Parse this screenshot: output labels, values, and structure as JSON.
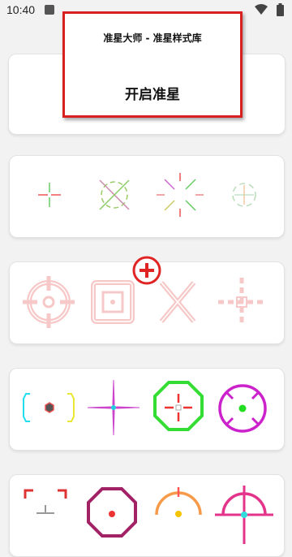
{
  "status_bar": {
    "time": "10:40"
  },
  "overlay": {
    "title": "准星大师 - 准星样式库",
    "open_button": "开启准星"
  },
  "crosshair_rows": [
    {
      "items": [
        "green-red-plus-icon",
        "rainbow-circle-x-icon",
        "rainbow-dashes-x-icon",
        "pastel-circle-plus-icon"
      ]
    },
    {
      "items": [
        "red-glow-circle-icon",
        "red-glow-square-icon",
        "red-glow-x-icon",
        "red-glow-dashed-plus-icon"
      ]
    },
    {
      "items": [
        "cyan-yellow-brackets-icon",
        "magenta-cyan-star-icon",
        "green-octagon-icon",
        "magenta-circle-icon"
      ]
    },
    {
      "items": [
        "red-corner-brackets-icon",
        "purple-octagon-icon",
        "orange-semicircle-icon",
        "magenta-circle-plus-icon"
      ]
    }
  ],
  "add_badge": {
    "icon": "add-circle-icon",
    "color": "#e53030"
  },
  "colors": {
    "overlay_border": "#d92020",
    "background": "#f2f2f2"
  }
}
